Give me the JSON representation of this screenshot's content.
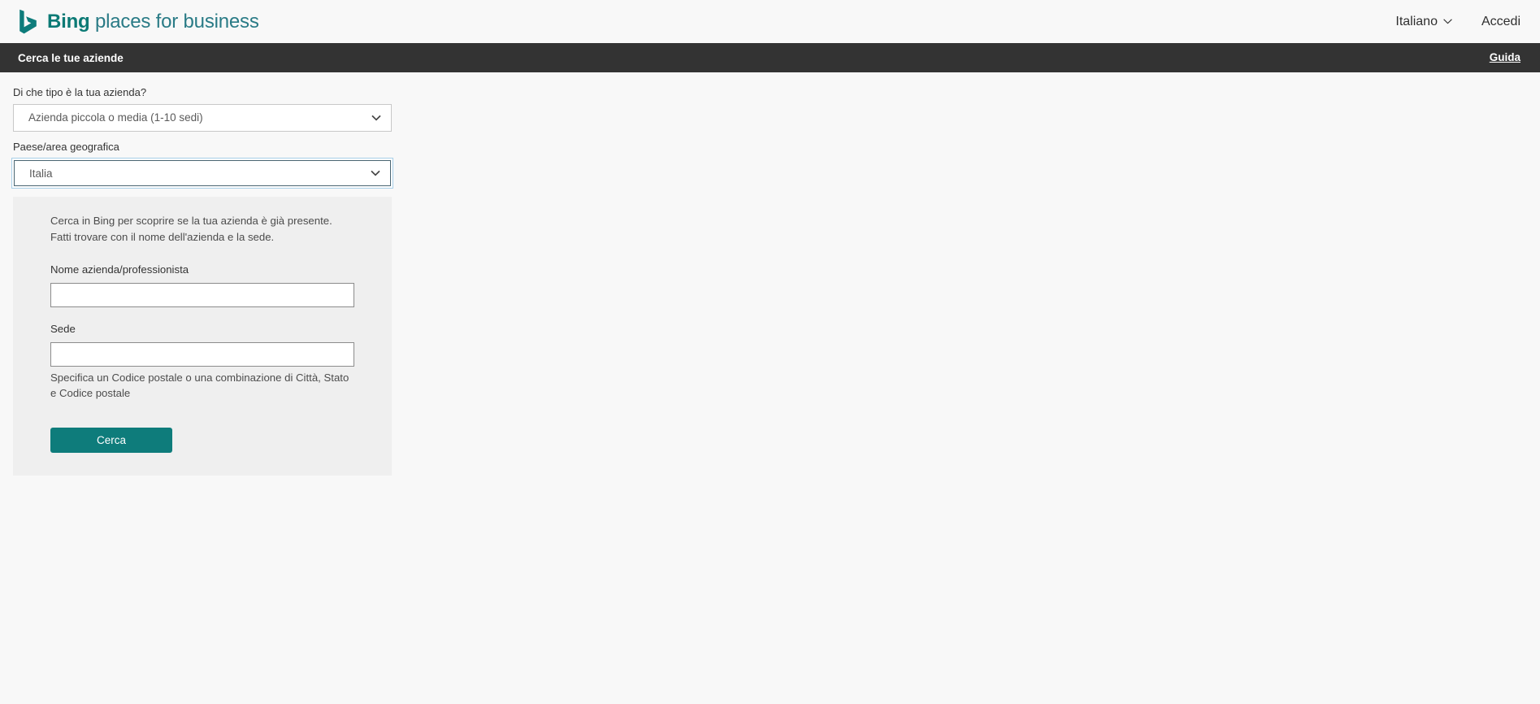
{
  "brand": {
    "logo_icon": "bing-b-logo-icon",
    "name_bold": "Bing",
    "name_light": " places for business",
    "language_label": "Italiano",
    "language_chevron_icon": "chevron-down-icon",
    "signin_label": "Accedi"
  },
  "subnav": {
    "title": "Cerca le tue aziende",
    "help_label": "Guida"
  },
  "form": {
    "business_type": {
      "label": "Di che tipo è la tua azienda?",
      "value": "Azienda piccola o media (1-10 sedi)",
      "chevron_icon": "chevron-down-icon"
    },
    "country": {
      "label": "Paese/area geografica",
      "value": "Italia",
      "chevron_icon": "chevron-down-icon"
    }
  },
  "panel": {
    "description": "Cerca in Bing per scoprire se la tua azienda è già presente. Fatti trovare con il nome dell'azienda e la sede.",
    "business_name": {
      "label": "Nome azienda/professionista",
      "value": "",
      "placeholder": ""
    },
    "location": {
      "label": "Sede",
      "value": "",
      "placeholder": ""
    },
    "location_hint": "Specifica un Codice postale o una combinazione di Città, Stato e Codice postale",
    "search_button_label": "Cerca"
  },
  "colors": {
    "brand_teal": "#0e7c7b",
    "subnav_dark": "#333333",
    "panel_gray": "#efefef",
    "page_bg": "#f8f8f8",
    "focus_ring": "#a8cfe8"
  }
}
